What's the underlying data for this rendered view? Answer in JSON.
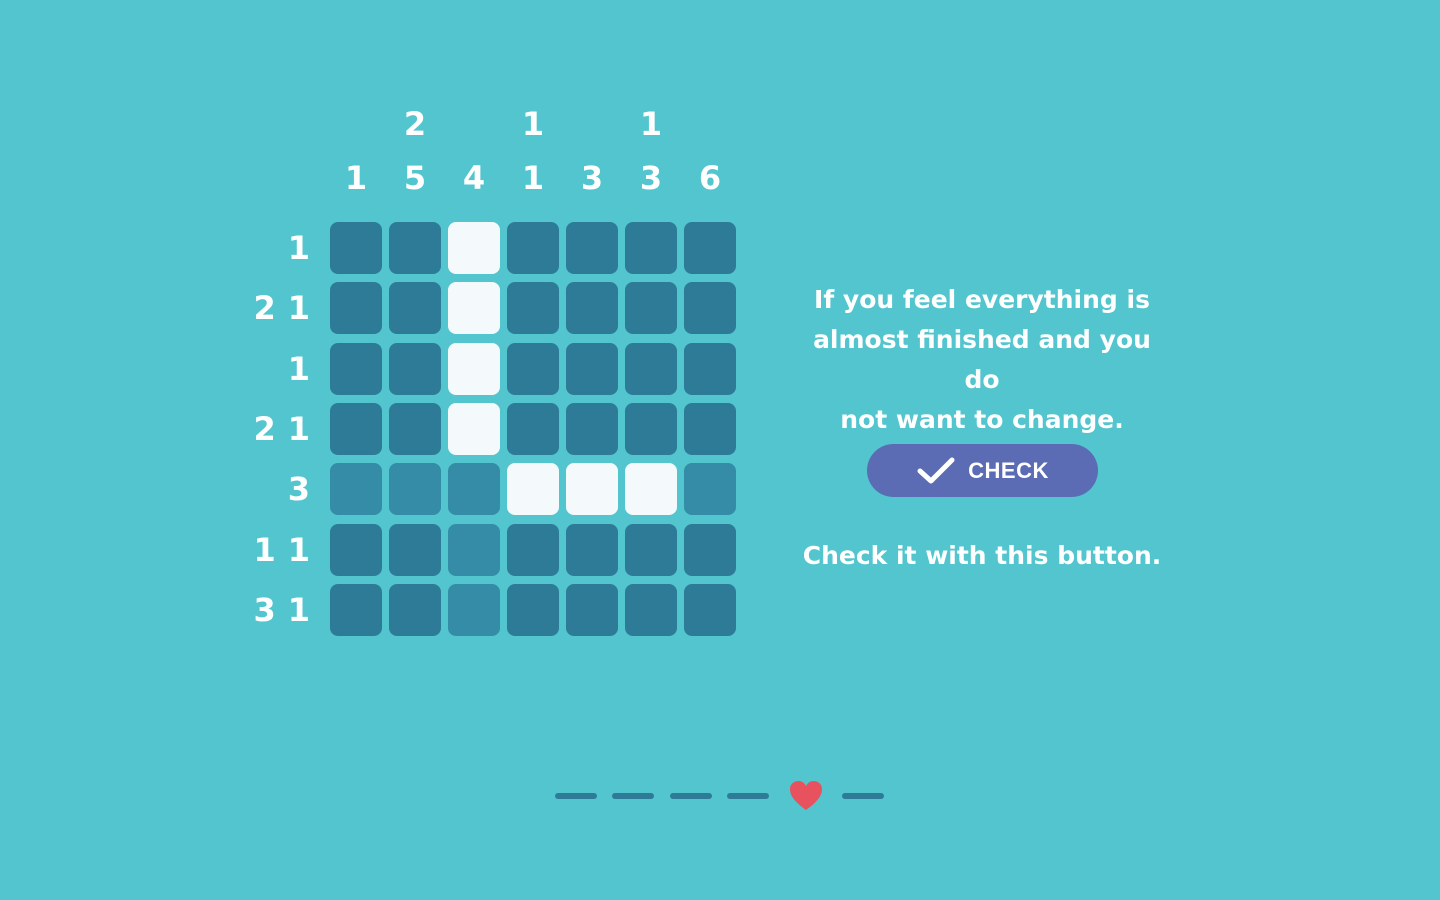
{
  "puzzle": {
    "size": 7,
    "column_clues": [
      [
        "1"
      ],
      [
        "2",
        "5"
      ],
      [
        "4"
      ],
      [
        "1",
        "1"
      ],
      [
        "3"
      ],
      [
        "1",
        "3"
      ],
      [
        "6"
      ]
    ],
    "row_clues": [
      [
        "1"
      ],
      [
        "2",
        "1"
      ],
      [
        "1"
      ],
      [
        "2",
        "1"
      ],
      [
        "3"
      ],
      [
        "1",
        "1"
      ],
      [
        "3",
        "1"
      ]
    ],
    "filled_cells": [
      [
        0,
        2
      ],
      [
        1,
        2
      ],
      [
        2,
        2
      ],
      [
        3,
        2
      ],
      [
        4,
        3
      ],
      [
        4,
        4
      ],
      [
        4,
        5
      ]
    ],
    "highlighted_row": 4,
    "highlighted_col": 2
  },
  "tutorial": {
    "hint_line1": "If you feel everything is",
    "hint_line2": "almost finished and you do",
    "hint_line3": "not want to change.",
    "check_label": "CHECK",
    "hint_after": "Check it with this button."
  },
  "progress": {
    "steps": 6,
    "current_step": 5,
    "current_icon": "heart-icon",
    "colors": {
      "dash": "#2e7b98",
      "heart": "#e8525e"
    }
  },
  "colors": {
    "background": "#52c5ce",
    "cell_empty": "#2e7b98",
    "cell_filled": "#f4f9fc",
    "button": "#5b6bb4"
  }
}
